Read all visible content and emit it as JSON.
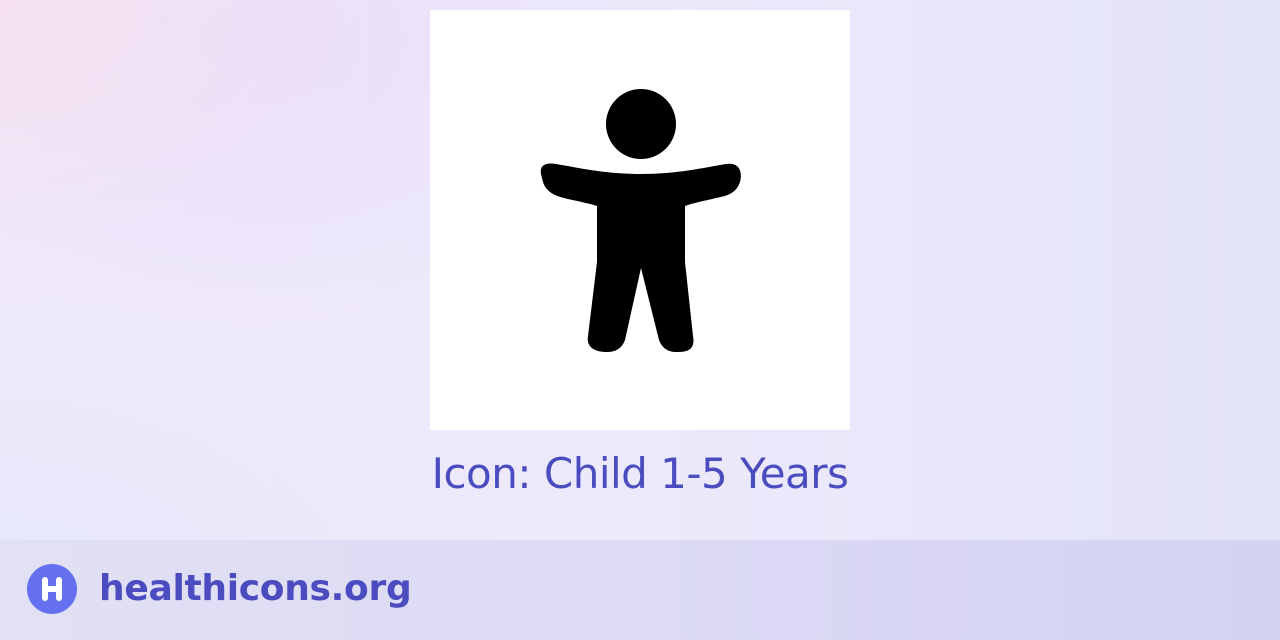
{
  "icon": {
    "name": "child-1-5-years-icon",
    "title": "Icon: Child 1-5 Years"
  },
  "footer": {
    "logo_icon": "healthicons-logo-icon",
    "site_name": "healthicons.org"
  },
  "colors": {
    "accent_text": "#4a4cc0",
    "logo_badge": "#6470f0",
    "icon_fill": "#000000",
    "card_background": "#ffffff"
  }
}
